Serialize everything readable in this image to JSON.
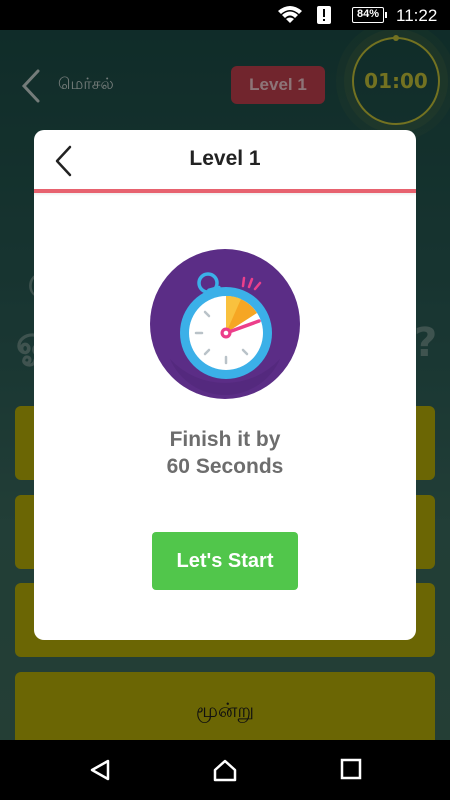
{
  "status_bar": {
    "battery_percent": "84%",
    "time": "11:22",
    "icons": [
      "wifi-icon",
      "alert-icon",
      "battery-icon"
    ]
  },
  "game": {
    "title": "மெர்சல்",
    "level": "Level 1",
    "timer": "01:00",
    "options": [
      "",
      "",
      "",
      "மூன்று"
    ]
  },
  "dialog": {
    "title": "Level 1",
    "message_line1": "Finish it by",
    "message_line2": "60 Seconds",
    "start_button": "Let's Start",
    "colors": {
      "divider": "#e7626f",
      "start_button": "#51c64b",
      "stopwatch_bg": "#5b2d86"
    }
  },
  "nav_bar": {
    "icons": [
      "back-triangle-icon",
      "home-icon",
      "recents-square-icon"
    ]
  }
}
